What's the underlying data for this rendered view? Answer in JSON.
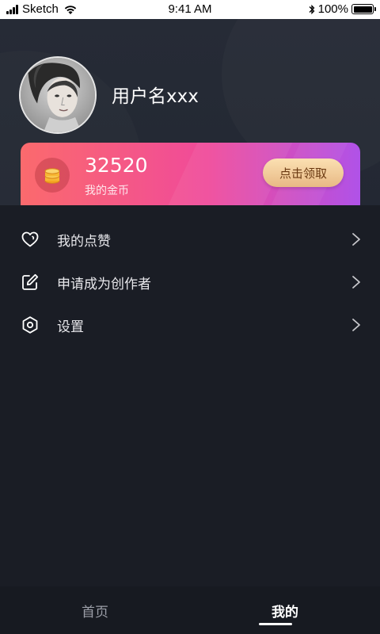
{
  "status_bar": {
    "carrier": "Sketch",
    "time": "9:41 AM",
    "battery": "100%",
    "icons": [
      "signal-icon",
      "wifi-icon",
      "bluetooth-icon",
      "battery-icon"
    ]
  },
  "profile": {
    "username": "用户名xxx",
    "avatar_icon": "avatar"
  },
  "coins": {
    "amount": "32520",
    "label": "我的金币",
    "claim_label": "点击领取",
    "icon": "coin-stack-icon"
  },
  "menu": {
    "items": [
      {
        "label": "我的点赞",
        "icon": "heart-icon"
      },
      {
        "label": "申请成为创作者",
        "icon": "edit-icon"
      },
      {
        "label": "设置",
        "icon": "settings-icon"
      }
    ]
  },
  "tabbar": {
    "tabs": [
      {
        "label": "首页",
        "active": false
      },
      {
        "label": "我的",
        "active": true
      }
    ]
  },
  "colors": {
    "background": "#1a1d25",
    "header": "#262b36",
    "card_gradient_start": "#fb6a6d",
    "card_gradient_end": "#b052e8",
    "claim_button": "#f2cf9e"
  }
}
